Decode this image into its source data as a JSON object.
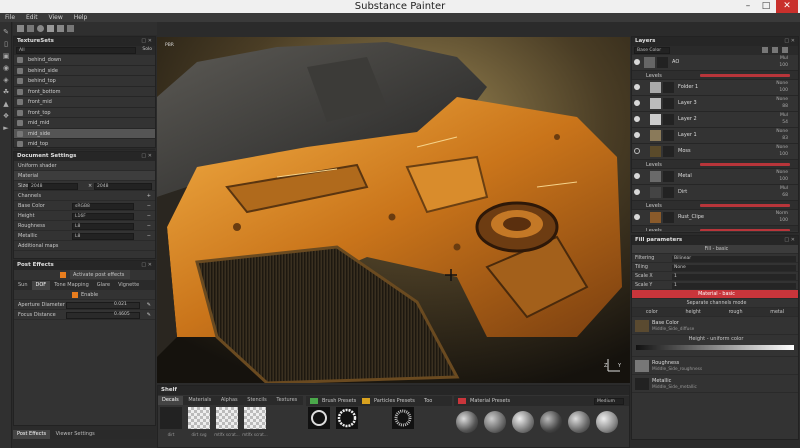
{
  "app": {
    "title": "Substance Painter"
  },
  "menu": [
    "File",
    "Edit",
    "View",
    "Help"
  ],
  "texture_sets": {
    "title": "TextureSets",
    "filter": "All",
    "solo": "Solo",
    "items": [
      "behind_down",
      "behind_side",
      "behind_top",
      "front_bottom",
      "front_mid",
      "front_top",
      "mid_mid",
      "mid_side",
      "mid_top"
    ],
    "selected_index": 7
  },
  "document_settings": {
    "title": "Document Settings",
    "shader": "Uniform shader",
    "material_label": "Material",
    "size_label": "Size",
    "size_value": "2048",
    "size_x": "×",
    "size_value2": "2048",
    "channels_label": "Channels",
    "channels": [
      {
        "name": "Base Color",
        "format": "sRGB8"
      },
      {
        "name": "Height",
        "format": "L16F"
      },
      {
        "name": "Roughness",
        "format": "L8"
      },
      {
        "name": "Metallic",
        "format": "L8"
      }
    ],
    "additional_maps": "Additional maps"
  },
  "post_effects": {
    "title": "Post Effects",
    "activate": "Activate post effects",
    "tabs": [
      "Sun",
      "DOF",
      "Tone Mapping",
      "Glare",
      "Vignette"
    ],
    "active_tab": 1,
    "enable": "Enable",
    "params": [
      {
        "name": "Aperture Diameter",
        "value": "0.021"
      },
      {
        "name": "Focus Distance",
        "value": "0.4605"
      }
    ]
  },
  "bottom_tabs": [
    "Post Effects",
    "Viewer Settings"
  ],
  "viewport": {
    "tag": "PBR"
  },
  "layers": {
    "title": "Layers",
    "channel": "Base Color",
    "rows": [
      {
        "kind": "layer",
        "name": "AO",
        "blend": "Mul",
        "opacity": "100",
        "eye": true,
        "indent": 0
      },
      {
        "kind": "levels",
        "name": "Levels"
      },
      {
        "kind": "layer",
        "name": "Folder 1",
        "blend": "None",
        "opacity": "100",
        "eye": true,
        "indent": 1
      },
      {
        "kind": "layer",
        "name": "Layer 3",
        "blend": "None",
        "opacity": "88",
        "eye": true,
        "indent": 1
      },
      {
        "kind": "layer",
        "name": "Layer 2",
        "blend": "Mul",
        "opacity": "54",
        "eye": true,
        "indent": 1
      },
      {
        "kind": "layer",
        "name": "Layer 1",
        "blend": "None",
        "opacity": "83",
        "eye": true,
        "indent": 1
      },
      {
        "kind": "layer",
        "name": "Moss",
        "blend": "None",
        "opacity": "100",
        "eye": false,
        "indent": 1
      },
      {
        "kind": "levels",
        "name": "Levels"
      },
      {
        "kind": "layer",
        "name": "Metal",
        "blend": "None",
        "opacity": "100",
        "eye": true,
        "indent": 1
      },
      {
        "kind": "layer",
        "name": "Dirt",
        "blend": "Mul",
        "opacity": "68",
        "eye": true,
        "indent": 1
      },
      {
        "kind": "levels",
        "name": "Levels"
      },
      {
        "kind": "layer",
        "name": "Rust_Clipe",
        "blend": "Norm",
        "opacity": "100",
        "eye": true,
        "indent": 1
      },
      {
        "kind": "levels",
        "name": "Levels"
      }
    ]
  },
  "fill_params": {
    "title": "Fill parameters",
    "header": "Fill - basic",
    "rows": [
      {
        "name": "Filtering",
        "value": "Bilinear"
      },
      {
        "name": "Tiling",
        "value": "None"
      },
      {
        "name": "Scale X",
        "value": "1"
      },
      {
        "name": "Scale Y",
        "value": "1"
      }
    ],
    "material_header": "Material - basic",
    "separate": "Separate channels mode",
    "channel_tabs": [
      "color",
      "height",
      "rough",
      "metal"
    ],
    "channels": [
      {
        "name": "Base Color",
        "sub": "Middle_Side_diffuse"
      },
      {
        "name": "Height - uniform color",
        "sub": ""
      },
      {
        "name": "Roughness",
        "sub": "Middle_Side_roughness"
      },
      {
        "name": "Metallic",
        "sub": "Middle_Side_metallic"
      }
    ]
  },
  "shelf": {
    "title": "Shelf",
    "tabs": [
      "Decals",
      "Materials",
      "Alphas",
      "Stencils",
      "Textures"
    ],
    "decals": [
      "dirt",
      "dirt svg",
      "mtlfx scrat...",
      "mtlfx scrat..."
    ],
    "brush_presets": "Brush Presets",
    "particles_presets": "Particles Presets",
    "tools_tab": "Too",
    "material_presets": "Material Presets",
    "size": "Medium"
  },
  "colors": {
    "accent_red": "#c9353b",
    "orange": "#e87d1e",
    "green": "#4aa84a",
    "yellow": "#d9a21f"
  }
}
